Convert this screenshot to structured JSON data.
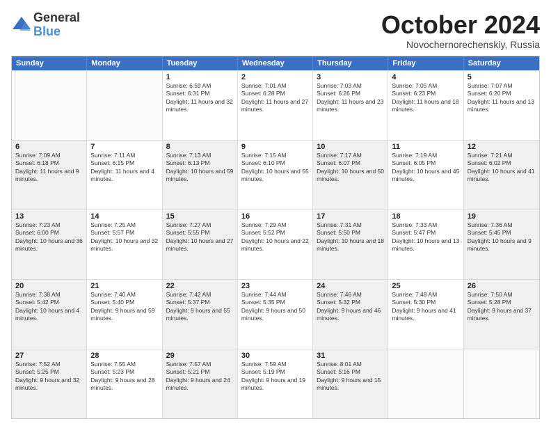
{
  "logo": {
    "general": "General",
    "blue": "Blue"
  },
  "title": "October 2024",
  "subtitle": "Novochernorechenskiy, Russia",
  "header_days": [
    "Sunday",
    "Monday",
    "Tuesday",
    "Wednesday",
    "Thursday",
    "Friday",
    "Saturday"
  ],
  "weeks": [
    [
      {
        "day": "",
        "info": "",
        "shaded": true
      },
      {
        "day": "",
        "info": "",
        "shaded": true
      },
      {
        "day": "1",
        "info": "Sunrise: 6:59 AM\nSunset: 6:31 PM\nDaylight: 11 hours and 32 minutes."
      },
      {
        "day": "2",
        "info": "Sunrise: 7:01 AM\nSunset: 6:28 PM\nDaylight: 11 hours and 27 minutes."
      },
      {
        "day": "3",
        "info": "Sunrise: 7:03 AM\nSunset: 6:26 PM\nDaylight: 11 hours and 23 minutes."
      },
      {
        "day": "4",
        "info": "Sunrise: 7:05 AM\nSunset: 6:23 PM\nDaylight: 11 hours and 18 minutes."
      },
      {
        "day": "5",
        "info": "Sunrise: 7:07 AM\nSunset: 6:20 PM\nDaylight: 11 hours and 13 minutes."
      }
    ],
    [
      {
        "day": "6",
        "info": "Sunrise: 7:09 AM\nSunset: 6:18 PM\nDaylight: 11 hours and 9 minutes.",
        "shaded": true
      },
      {
        "day": "7",
        "info": "Sunrise: 7:11 AM\nSunset: 6:15 PM\nDaylight: 11 hours and 4 minutes."
      },
      {
        "day": "8",
        "info": "Sunrise: 7:13 AM\nSunset: 6:13 PM\nDaylight: 10 hours and 59 minutes.",
        "shaded": true
      },
      {
        "day": "9",
        "info": "Sunrise: 7:15 AM\nSunset: 6:10 PM\nDaylight: 10 hours and 55 minutes."
      },
      {
        "day": "10",
        "info": "Sunrise: 7:17 AM\nSunset: 6:07 PM\nDaylight: 10 hours and 50 minutes.",
        "shaded": true
      },
      {
        "day": "11",
        "info": "Sunrise: 7:19 AM\nSunset: 6:05 PM\nDaylight: 10 hours and 45 minutes."
      },
      {
        "day": "12",
        "info": "Sunrise: 7:21 AM\nSunset: 6:02 PM\nDaylight: 10 hours and 41 minutes.",
        "shaded": true
      }
    ],
    [
      {
        "day": "13",
        "info": "Sunrise: 7:23 AM\nSunset: 6:00 PM\nDaylight: 10 hours and 36 minutes.",
        "shaded": true
      },
      {
        "day": "14",
        "info": "Sunrise: 7:25 AM\nSunset: 5:57 PM\nDaylight: 10 hours and 32 minutes."
      },
      {
        "day": "15",
        "info": "Sunrise: 7:27 AM\nSunset: 5:55 PM\nDaylight: 10 hours and 27 minutes.",
        "shaded": true
      },
      {
        "day": "16",
        "info": "Sunrise: 7:29 AM\nSunset: 5:52 PM\nDaylight: 10 hours and 22 minutes."
      },
      {
        "day": "17",
        "info": "Sunrise: 7:31 AM\nSunset: 5:50 PM\nDaylight: 10 hours and 18 minutes.",
        "shaded": true
      },
      {
        "day": "18",
        "info": "Sunrise: 7:33 AM\nSunset: 5:47 PM\nDaylight: 10 hours and 13 minutes."
      },
      {
        "day": "19",
        "info": "Sunrise: 7:36 AM\nSunset: 5:45 PM\nDaylight: 10 hours and 9 minutes.",
        "shaded": true
      }
    ],
    [
      {
        "day": "20",
        "info": "Sunrise: 7:38 AM\nSunset: 5:42 PM\nDaylight: 10 hours and 4 minutes.",
        "shaded": true
      },
      {
        "day": "21",
        "info": "Sunrise: 7:40 AM\nSunset: 5:40 PM\nDaylight: 9 hours and 59 minutes."
      },
      {
        "day": "22",
        "info": "Sunrise: 7:42 AM\nSunset: 5:37 PM\nDaylight: 9 hours and 55 minutes.",
        "shaded": true
      },
      {
        "day": "23",
        "info": "Sunrise: 7:44 AM\nSunset: 5:35 PM\nDaylight: 9 hours and 50 minutes."
      },
      {
        "day": "24",
        "info": "Sunrise: 7:46 AM\nSunset: 5:32 PM\nDaylight: 9 hours and 46 minutes.",
        "shaded": true
      },
      {
        "day": "25",
        "info": "Sunrise: 7:48 AM\nSunset: 5:30 PM\nDaylight: 9 hours and 41 minutes."
      },
      {
        "day": "26",
        "info": "Sunrise: 7:50 AM\nSunset: 5:28 PM\nDaylight: 9 hours and 37 minutes.",
        "shaded": true
      }
    ],
    [
      {
        "day": "27",
        "info": "Sunrise: 7:52 AM\nSunset: 5:25 PM\nDaylight: 9 hours and 32 minutes.",
        "shaded": true
      },
      {
        "day": "28",
        "info": "Sunrise: 7:55 AM\nSunset: 5:23 PM\nDaylight: 9 hours and 28 minutes."
      },
      {
        "day": "29",
        "info": "Sunrise: 7:57 AM\nSunset: 5:21 PM\nDaylight: 9 hours and 24 minutes.",
        "shaded": true
      },
      {
        "day": "30",
        "info": "Sunrise: 7:59 AM\nSunset: 5:19 PM\nDaylight: 9 hours and 19 minutes."
      },
      {
        "day": "31",
        "info": "Sunrise: 8:01 AM\nSunset: 5:16 PM\nDaylight: 9 hours and 15 minutes.",
        "shaded": true
      },
      {
        "day": "",
        "info": "",
        "shaded": true
      },
      {
        "day": "",
        "info": "",
        "shaded": true
      }
    ]
  ]
}
